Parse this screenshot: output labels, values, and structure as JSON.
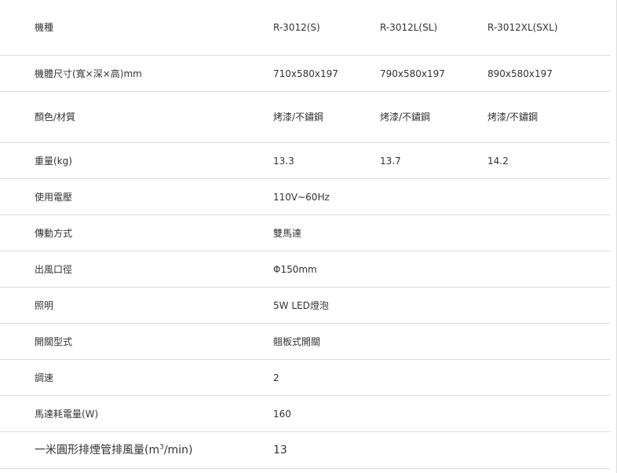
{
  "spec_table": {
    "header": {
      "label": "機種",
      "models": [
        "R-3012(S)",
        "R-3012L(SL)",
        "R-3012XL(SXL)"
      ]
    },
    "rows": [
      {
        "label": "機體尺寸(寬×深×高)mm",
        "values": [
          "710x580x197",
          "790x580x197",
          "890x580x197"
        ]
      },
      {
        "label": "顏色/材質",
        "values": [
          "烤漆/不鏽鋼",
          "烤漆/不鏽鋼",
          "烤漆/不鏽鋼"
        ]
      },
      {
        "label": "重量(kg)",
        "values": [
          "13.3",
          "13.7",
          "14.2"
        ]
      },
      {
        "label": "使用電壓",
        "value": "110V~60Hz"
      },
      {
        "label": "傳動方式",
        "value": "雙馬達"
      },
      {
        "label": "出風口徑",
        "value": "Φ150mm"
      },
      {
        "label": "照明",
        "value": "5W LED燈泡"
      },
      {
        "label": "開關型式",
        "value": "翹板式開關"
      },
      {
        "label": "調速",
        "value": "2"
      },
      {
        "label": "馬達耗電量(W)",
        "value": "160"
      }
    ],
    "last_row": {
      "label_prefix": "一米圓形排煙管排風量(m",
      "label_sup": "3",
      "label_suffix": "/min)",
      "value": "13"
    }
  }
}
